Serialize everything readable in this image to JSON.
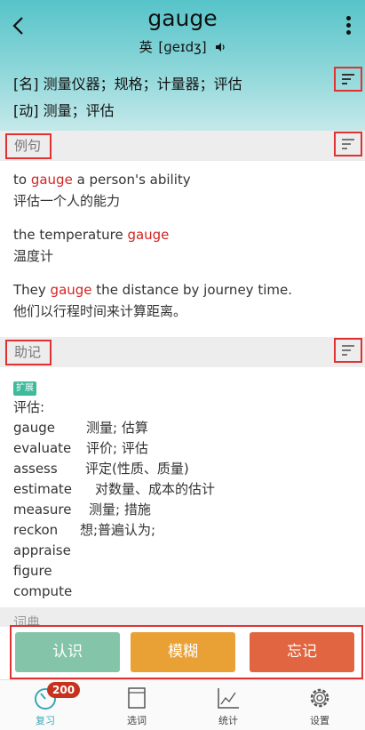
{
  "header": {
    "word": "gauge",
    "accent": "英",
    "phonetic": "[ɡeɪdʒ]",
    "definitions": [
      "[名] 测量仪器；规格；计量器；评估",
      "[动] 测量；评估"
    ]
  },
  "sections": {
    "examples_label": "例句",
    "memory_label": "助记",
    "dictionary_label": "词典"
  },
  "examples": [
    {
      "en_before": "to ",
      "highlight": "gauge",
      "en_after": " a person's ability",
      "zh": "评估一个人的能力"
    },
    {
      "en_before": "the temperature ",
      "highlight": "gauge",
      "en_after": "",
      "zh": "温度计"
    },
    {
      "en_before": "They ",
      "highlight": "gauge",
      "en_after": " the distance by journey time.",
      "zh": "他们以行程时间来计算距离。"
    }
  ],
  "memory": {
    "badge": "扩展",
    "title": "评估:",
    "rows": [
      {
        "word": "gauge",
        "meaning": "测量; 估算"
      },
      {
        "word": "evaluate",
        "meaning": "评价; 评估"
      },
      {
        "word": "assess",
        "meaning": "评定(性质、质量)"
      },
      {
        "word": "estimate",
        "meaning": "对数量、成本的估计"
      },
      {
        "word": "measure",
        "meaning": "测量; 措施"
      },
      {
        "word": "reckon",
        "meaning": "想;普遍认为;"
      },
      {
        "word": "appraise",
        "meaning": ""
      },
      {
        "word": "figure",
        "meaning": ""
      },
      {
        "word": "compute",
        "meaning": ""
      }
    ]
  },
  "actions": {
    "know": "认识",
    "vague": "模糊",
    "forget": "忘记"
  },
  "tabs": {
    "review": "复习",
    "review_count": "200",
    "select": "选词",
    "stats": "统计",
    "settings": "设置"
  },
  "colors": {
    "header": "#56c4c9",
    "highlight": "#d32424",
    "know": "#84c4a8",
    "vague": "#e9a136",
    "forget": "#e06540",
    "badge": "#3dbb9c",
    "active_tab": "#3aa7b5"
  },
  "icons": [
    "back-arrow-icon",
    "more-vertical-icon",
    "speaker-icon",
    "sort-lines-icon",
    "review-timer-icon",
    "book-icon",
    "line-chart-icon",
    "gear-icon"
  ]
}
